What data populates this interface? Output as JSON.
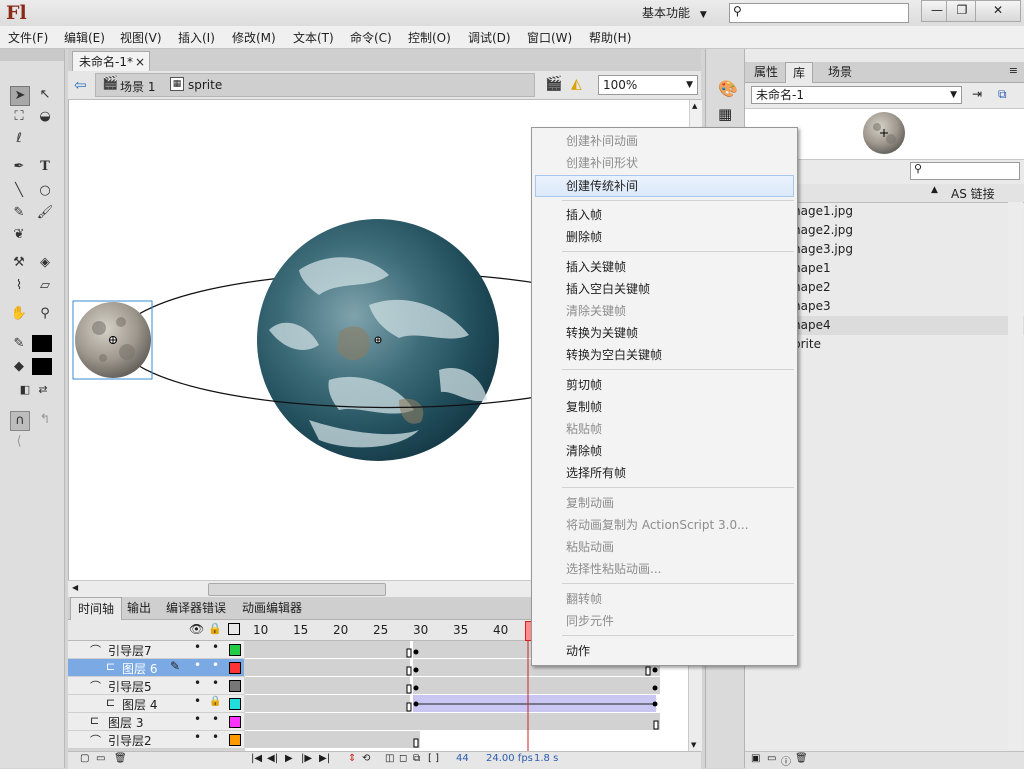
{
  "app": {
    "logo": "Fl",
    "workspace": "基本功能",
    "window_controls": {
      "minimize": "—",
      "maximize": "❐",
      "close": "✕"
    }
  },
  "menu": [
    "文件(F)",
    "编辑(E)",
    "视图(V)",
    "插入(I)",
    "修改(M)",
    "文本(T)",
    "命令(C)",
    "控制(O)",
    "调试(D)",
    "窗口(W)",
    "帮助(H)"
  ],
  "document": {
    "tab_title": "未命名-1*",
    "tab_close": "×",
    "breadcrumb": [
      "场景 1",
      "sprite"
    ],
    "zoom": "100%"
  },
  "timeline": {
    "tabs": [
      "时间轴",
      "输出",
      "编译器错误",
      "动画编辑器"
    ],
    "ruler": [
      "10",
      "15",
      "20",
      "25",
      "30",
      "35",
      "40"
    ],
    "layers": [
      {
        "name": "引导层7",
        "kind": "guide",
        "selected": false
      },
      {
        "name": "图层 6",
        "kind": "guided",
        "selected": true
      },
      {
        "name": "引导层5",
        "kind": "guide",
        "selected": false
      },
      {
        "name": "图层 4",
        "kind": "guided",
        "selected": false,
        "locked": true
      },
      {
        "name": "图层 3",
        "kind": "normal",
        "selected": false
      },
      {
        "name": "引导层2",
        "kind": "guide",
        "selected": false
      }
    ],
    "layer_colors": [
      "#22cc44",
      "#ff3333",
      "#777777",
      "#22dddd",
      "#ff33ff",
      "#ff9900"
    ],
    "current_frame": "44",
    "fps": "24.00 fps",
    "elapsed": "1.8 s"
  },
  "library": {
    "tabs": [
      "属性",
      "库",
      "场景"
    ],
    "document": "未命名-1",
    "column_header": "AS 链接",
    "items": [
      {
        "name": "nage1.jpg",
        "selected": false
      },
      {
        "name": "nage2.jpg",
        "selected": false
      },
      {
        "name": "nage3.jpg",
        "selected": false
      },
      {
        "name": "nape1",
        "selected": false
      },
      {
        "name": "nape2",
        "selected": false
      },
      {
        "name": "nape3",
        "selected": false
      },
      {
        "name": "nape4",
        "selected": true
      },
      {
        "name": "prite",
        "selected": false
      }
    ]
  },
  "context_menu": {
    "items": [
      {
        "label": "创建补间动画",
        "disabled": true
      },
      {
        "label": "创建补间形状",
        "disabled": true
      },
      {
        "label": "创建传统补间",
        "disabled": false,
        "hover": true
      },
      {
        "sep": true
      },
      {
        "label": "插入帧",
        "disabled": false
      },
      {
        "label": "删除帧",
        "disabled": false
      },
      {
        "sep": true
      },
      {
        "label": "插入关键帧",
        "disabled": false
      },
      {
        "label": "插入空白关键帧",
        "disabled": false
      },
      {
        "label": "清除关键帧",
        "disabled": true
      },
      {
        "label": "转换为关键帧",
        "disabled": false
      },
      {
        "label": "转换为空白关键帧",
        "disabled": false
      },
      {
        "sep": true
      },
      {
        "label": "剪切帧",
        "disabled": false
      },
      {
        "label": "复制帧",
        "disabled": false
      },
      {
        "label": "粘贴帧",
        "disabled": true
      },
      {
        "label": "清除帧",
        "disabled": false
      },
      {
        "label": "选择所有帧",
        "disabled": false
      },
      {
        "sep": true
      },
      {
        "label": "复制动画",
        "disabled": true
      },
      {
        "label": "将动画复制为 ActionScript 3.0...",
        "disabled": true
      },
      {
        "label": "粘贴动画",
        "disabled": true
      },
      {
        "label": "选择性粘贴动画...",
        "disabled": true
      },
      {
        "sep": true
      },
      {
        "label": "翻转帧",
        "disabled": true
      },
      {
        "label": "同步元件",
        "disabled": true
      },
      {
        "sep": true
      },
      {
        "label": "动作",
        "disabled": false
      }
    ]
  }
}
